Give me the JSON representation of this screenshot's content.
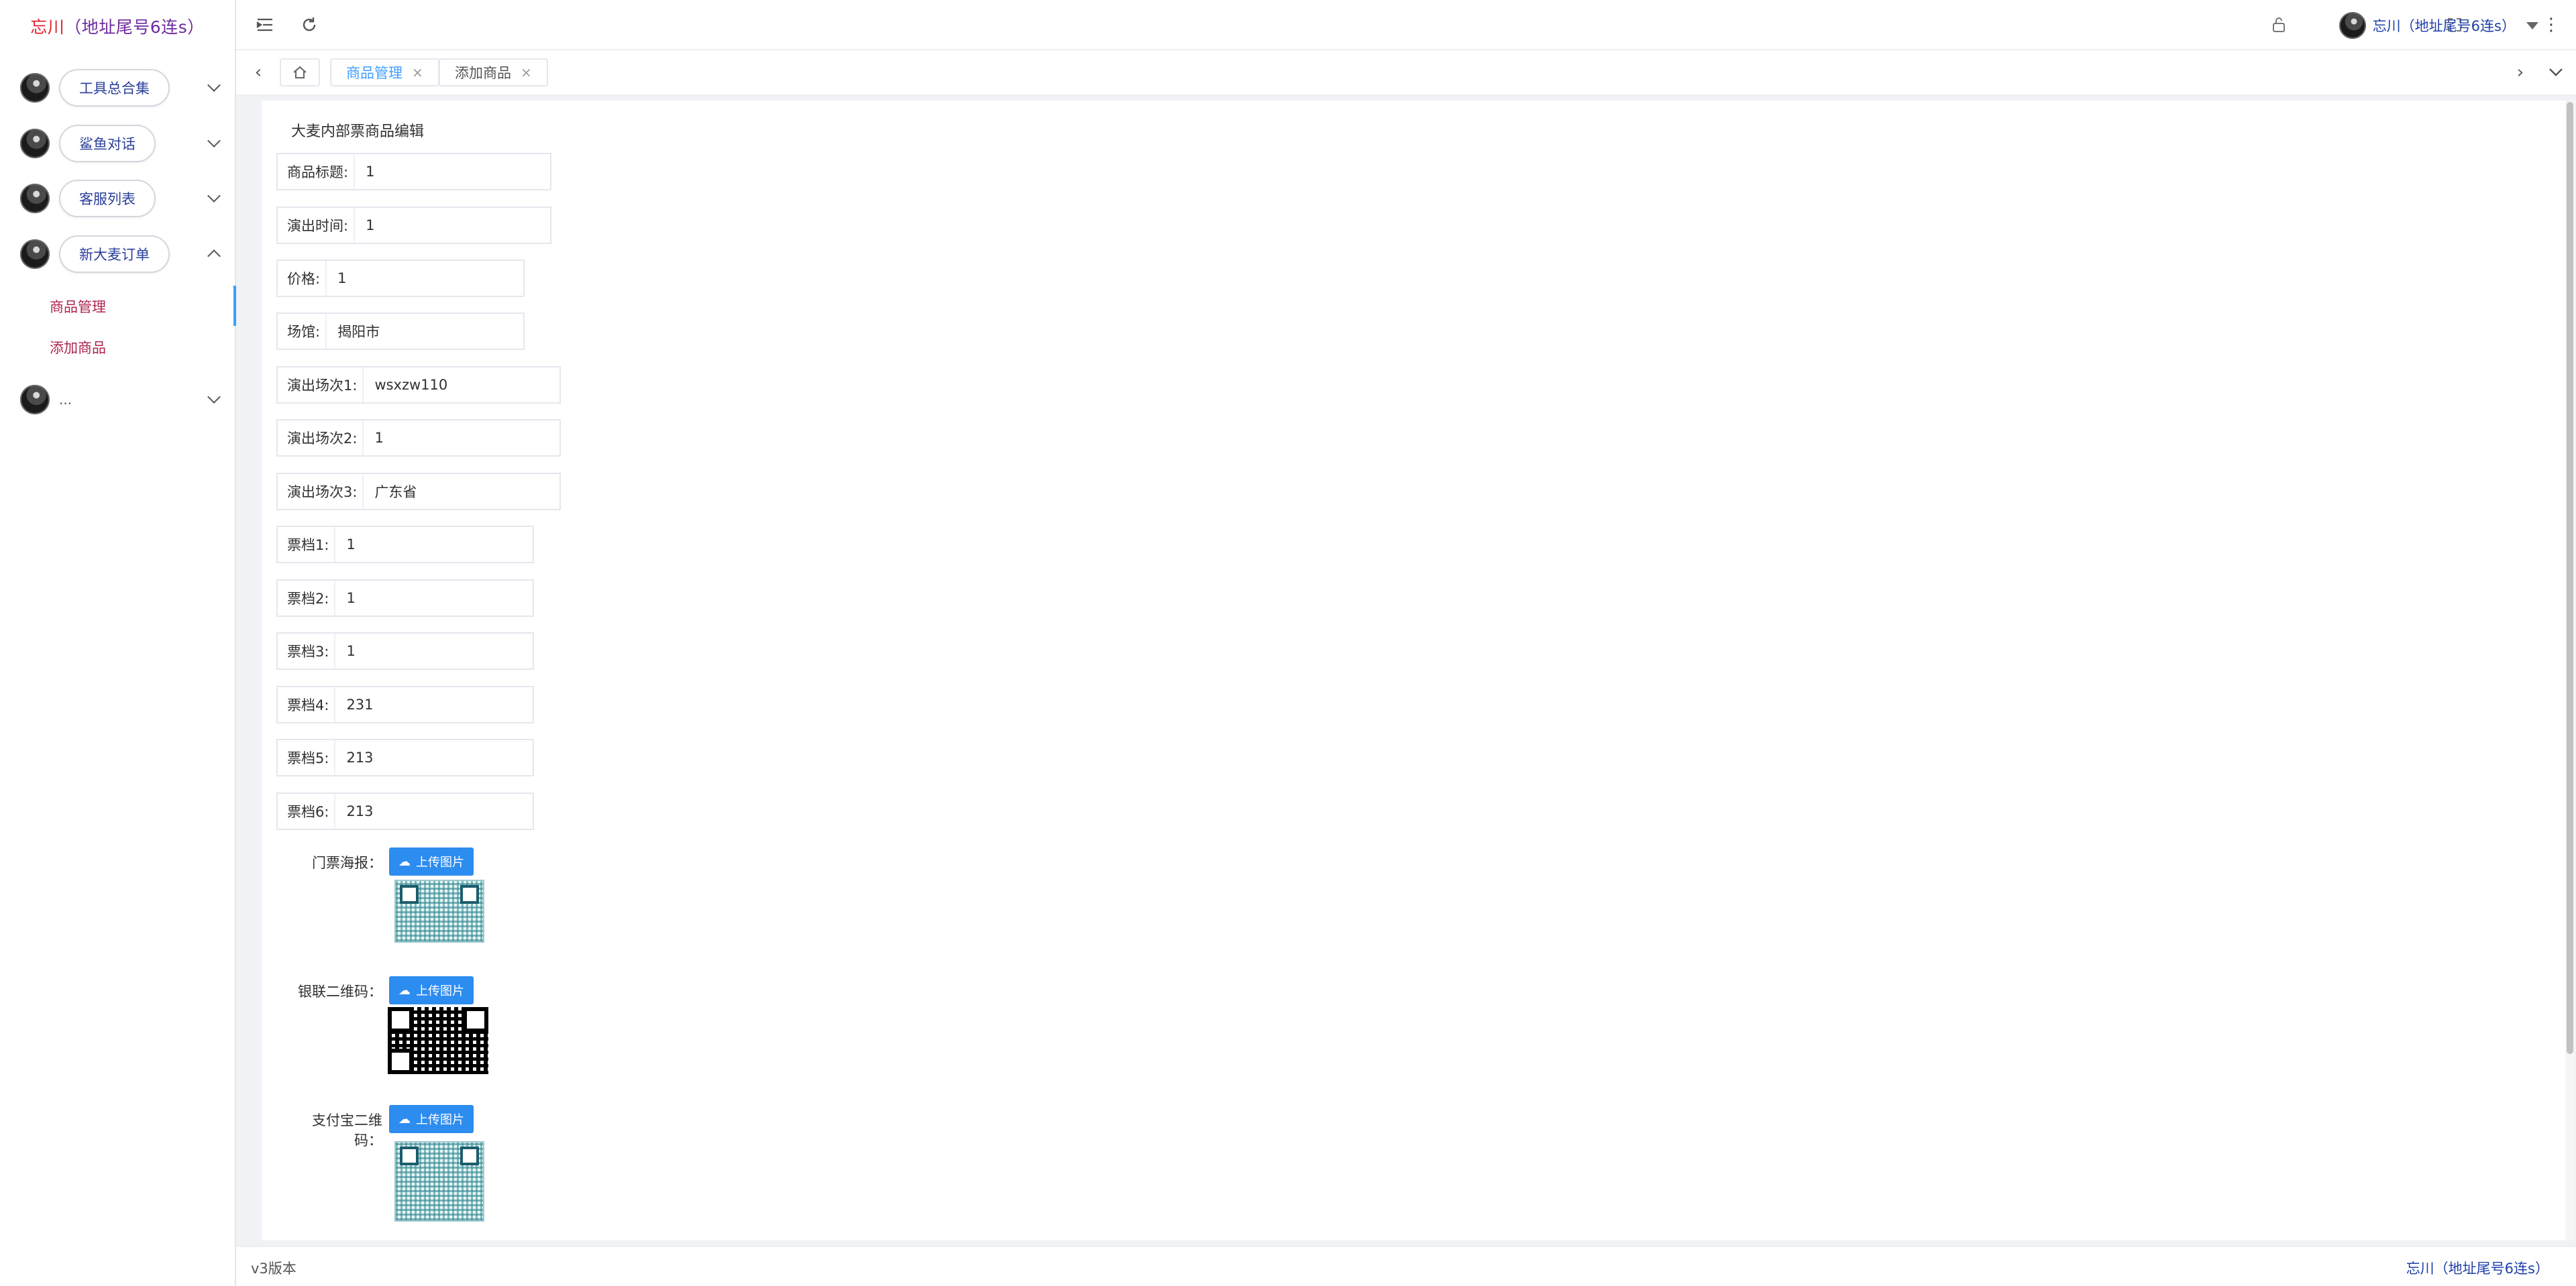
{
  "sidebar": {
    "brand_name": "忘川",
    "brand_suffix": "（地址尾号6连s）",
    "items": [
      {
        "label": "工具总合集"
      },
      {
        "label": "鲨鱼对话"
      },
      {
        "label": "客服列表"
      },
      {
        "label": "新大麦订单"
      },
      {
        "label": "..."
      }
    ],
    "sub_items": [
      {
        "label": "商品管理"
      },
      {
        "label": "添加商品"
      }
    ]
  },
  "header": {
    "menu_icon": "menu-fold-icon",
    "refresh_icon": "refresh-icon",
    "fullscreen_icon": "fullscreen-icon",
    "lock_icon": "lock-icon",
    "user_name": "忘川（地址尾号6连s）",
    "more_icon": "more-vertical-icon"
  },
  "tabs": {
    "items": [
      {
        "label": "商品管理",
        "close": "×"
      },
      {
        "label": "添加商品",
        "close": "×"
      }
    ]
  },
  "form": {
    "title": "大麦内部票商品编辑",
    "fields": [
      {
        "label": "商品标题:",
        "value": "1"
      },
      {
        "label": "演出时间:",
        "value": "1"
      },
      {
        "label": "价格:",
        "value": "1"
      },
      {
        "label": "场馆:",
        "value": "揭阳市"
      },
      {
        "label": "演出场次1:",
        "value": "wsxzw110"
      },
      {
        "label": "演出场次2:",
        "value": "1"
      },
      {
        "label": "演出场次3:",
        "value": "广东省"
      },
      {
        "label": "票档1:",
        "value": "1"
      },
      {
        "label": "票档2:",
        "value": "1"
      },
      {
        "label": "票档3:",
        "value": "1"
      },
      {
        "label": "票档4:",
        "value": "231"
      },
      {
        "label": "票档5:",
        "value": "213"
      },
      {
        "label": "票档6:",
        "value": "213"
      }
    ],
    "uploads": [
      {
        "label": "门票海报：",
        "button": "上传图片"
      },
      {
        "label": "银联二维码：",
        "button": "上传图片"
      },
      {
        "label": "支付宝二维码：",
        "button": "上传图片"
      }
    ]
  },
  "footer": {
    "version": "v3版本",
    "user": "忘川（地址尾号6连s）"
  },
  "colors": {
    "accent": "#409eff",
    "upload_button": "#2d8cf0",
    "brand_red": "#e0222e",
    "submenu_text": "#b0244d"
  }
}
